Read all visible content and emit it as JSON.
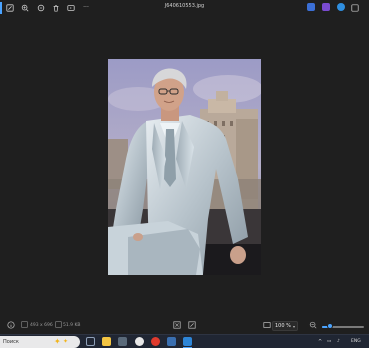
{
  "window": {
    "filename": "J640610553.jpg"
  },
  "toolbar": {
    "more_label": "···"
  },
  "status": {
    "dimensions": "493 x 696",
    "filesize": "51.9 KB"
  },
  "zoom": {
    "level": "100 %",
    "slider_fraction": 0.18
  },
  "taskbar": {
    "search_text": "Поиск",
    "tray_lang": "ENG"
  },
  "colors": {
    "accent": "#4aa3ff",
    "background": "#1f1f1f",
    "taskbar": "#202633"
  }
}
